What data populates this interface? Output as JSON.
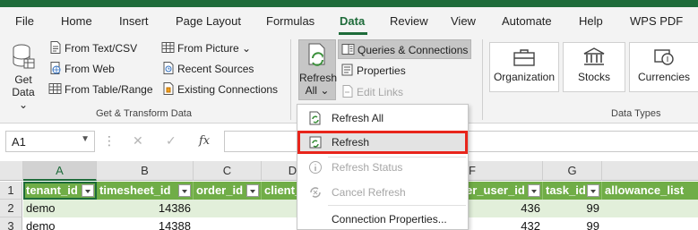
{
  "ribbon_tabs": [
    "File",
    "Home",
    "Insert",
    "Page Layout",
    "Formulas",
    "Data",
    "Review",
    "View",
    "Automate",
    "Help",
    "WPS PDF"
  ],
  "active_tab": "Data",
  "get_transform": {
    "get_data_line1": "Get",
    "get_data_line2": "Data",
    "from_text_csv": "From Text/CSV",
    "from_web": "From Web",
    "from_table_range": "From Table/Range",
    "from_picture": "From Picture",
    "recent_sources": "Recent Sources",
    "existing_connections": "Existing Connections",
    "group_label": "Get & Transform Data"
  },
  "queries": {
    "refresh_all_line1": "Refresh",
    "refresh_all_line2": "All",
    "queries_connections": "Queries & Connections",
    "properties": "Properties",
    "edit_links": "Edit Links"
  },
  "data_types": {
    "organization": "Organization",
    "stocks": "Stocks",
    "currencies": "Currencies",
    "group_label": "Data Types"
  },
  "refresh_menu": {
    "refresh_all": "Refresh All",
    "refresh": "Refresh",
    "refresh_status": "Refresh Status",
    "cancel_refresh": "Cancel Refresh",
    "connection_properties": "Connection Properties..."
  },
  "formula_bar": {
    "name_box": "A1",
    "fx": "fx",
    "formula": ""
  },
  "sheet": {
    "columns": [
      "A",
      "B",
      "C",
      "D",
      "F",
      "G"
    ],
    "rows": [
      "1",
      "2",
      "3"
    ],
    "headers": {
      "tenant_id": "tenant_id",
      "timesheet_id": "timesheet_id",
      "order_id": "order_id",
      "client": "client_",
      "user_id": "er_user_id",
      "task_id": "task_id",
      "allowance_list": "allowance_list"
    },
    "data_rows": [
      {
        "tenant_id": "demo",
        "timesheet_id": "14386",
        "user_id": "436",
        "task_id": "99"
      },
      {
        "tenant_id": "demo",
        "timesheet_id": "14388",
        "user_id": "432",
        "task_id": "99"
      }
    ]
  },
  "colors": {
    "accent_green": "#1e6b3a",
    "table_header_green": "#70ad47",
    "banded_row": "#e2efda",
    "highlight_red": "#e8251b"
  }
}
